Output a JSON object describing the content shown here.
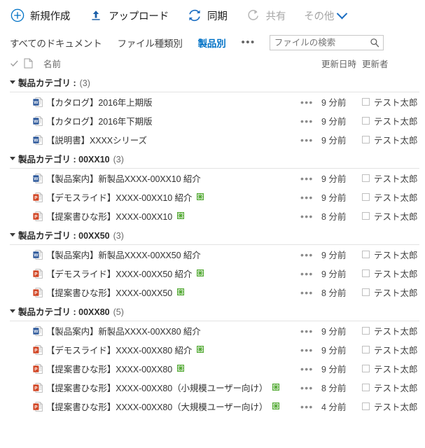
{
  "commandbar": {
    "items": [
      {
        "label": "新規作成",
        "icon": "plus-circle-icon",
        "disabled": false
      },
      {
        "label": "アップロード",
        "icon": "upload-arrow-icon",
        "disabled": false
      },
      {
        "label": "同期",
        "icon": "sync-icon",
        "disabled": false
      },
      {
        "label": "共有",
        "icon": "share-icon",
        "disabled": true
      },
      {
        "label": "その他",
        "icon": "chevron-down-icon",
        "disabled": true
      }
    ]
  },
  "viewbar": {
    "views": [
      {
        "label": "すべてのドキュメント",
        "selected": false
      },
      {
        "label": "ファイル種類別",
        "selected": false
      },
      {
        "label": "製品別",
        "selected": true
      }
    ],
    "more_label": "•••",
    "search": {
      "placeholder": "ファイルの検索",
      "value": "",
      "icon": "search-icon"
    }
  },
  "columns": {
    "select_all_icon": "checkmark-icon",
    "type_icon": "document-icon",
    "name": "名前",
    "modified": "更新日時",
    "editor": "更新者"
  },
  "row_menu_label": "•••",
  "colors": {
    "accent": "#0072c6",
    "word": "#2b579a",
    "powerpoint": "#d24726",
    "new_badge": "#4ea72e",
    "text": "#333333",
    "muted": "#666666"
  },
  "groups": [
    {
      "field": "製品カテゴリ :",
      "value": "",
      "count": "(3)",
      "items": [
        {
          "name": "【カタログ】2016年上期版",
          "filetype": "word",
          "is_new": false,
          "modified": "9 分前",
          "editor": "テスト太郎"
        },
        {
          "name": "【カタログ】2016年下期版",
          "filetype": "word",
          "is_new": false,
          "modified": "9 分前",
          "editor": "テスト太郎"
        },
        {
          "name": "【説明書】XXXXシリーズ",
          "filetype": "word",
          "is_new": false,
          "modified": "9 分前",
          "editor": "テスト太郎"
        }
      ]
    },
    {
      "field": "製品カテゴリ :",
      "value": "00XX10",
      "count": "(3)",
      "items": [
        {
          "name": "【製品案内】新製品XXXX-00XX10 紹介",
          "filetype": "word",
          "is_new": false,
          "modified": "9 分前",
          "editor": "テスト太郎"
        },
        {
          "name": "【デモスライド】XXXX-00XX10 紹介",
          "filetype": "powerpoint",
          "is_new": true,
          "modified": "9 分前",
          "editor": "テスト太郎"
        },
        {
          "name": "【提案書ひな形】XXXX-00XX10",
          "filetype": "powerpoint",
          "is_new": true,
          "modified": "8 分前",
          "editor": "テスト太郎"
        }
      ]
    },
    {
      "field": "製品カテゴリ :",
      "value": "00XX50",
      "count": "(3)",
      "items": [
        {
          "name": "【製品案内】新製品XXXX-00XX50 紹介",
          "filetype": "word",
          "is_new": false,
          "modified": "9 分前",
          "editor": "テスト太郎"
        },
        {
          "name": "【デモスライド】XXXX-00XX50 紹介",
          "filetype": "powerpoint",
          "is_new": true,
          "modified": "9 分前",
          "editor": "テスト太郎"
        },
        {
          "name": "【提案書ひな形】XXXX-00XX50",
          "filetype": "powerpoint",
          "is_new": true,
          "modified": "8 分前",
          "editor": "テスト太郎"
        }
      ]
    },
    {
      "field": "製品カテゴリ :",
      "value": "00XX80",
      "count": "(5)",
      "items": [
        {
          "name": "【製品案内】新製品XXXX-00XX80 紹介",
          "filetype": "word",
          "is_new": false,
          "modified": "9 分前",
          "editor": "テスト太郎"
        },
        {
          "name": "【デモスライド】XXXX-00XX80 紹介",
          "filetype": "powerpoint",
          "is_new": true,
          "modified": "9 分前",
          "editor": "テスト太郎"
        },
        {
          "name": "【提案書ひな形】XXXX-00XX80",
          "filetype": "powerpoint",
          "is_new": true,
          "modified": "9 分前",
          "editor": "テスト太郎"
        },
        {
          "name": "【提案書ひな形】XXXX-00XX80（小規模ユーザー向け）",
          "filetype": "powerpoint",
          "is_new": true,
          "modified": "8 分前",
          "editor": "テスト太郎"
        },
        {
          "name": "【提案書ひな形】XXXX-00XX80（大規模ユーザー向け）",
          "filetype": "powerpoint",
          "is_new": true,
          "modified": "4 分前",
          "editor": "テスト太郎"
        }
      ]
    }
  ]
}
